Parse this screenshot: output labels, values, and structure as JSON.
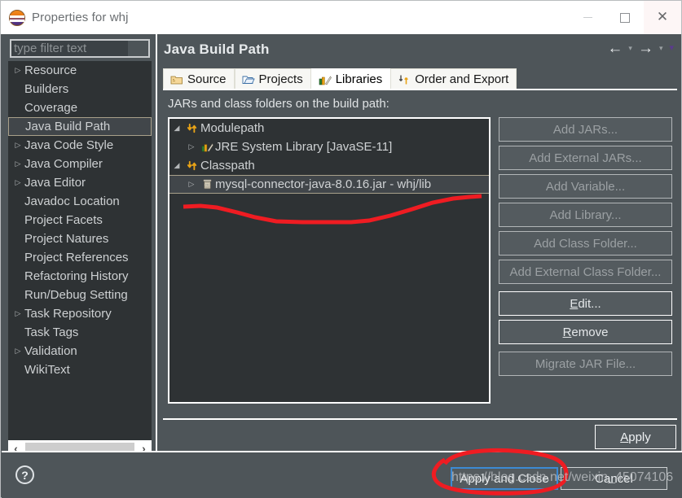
{
  "window": {
    "title": "Properties for whj",
    "icon": "eclipse-icon",
    "controls": {
      "minimize": "—",
      "maximize": "□",
      "close": "✕"
    }
  },
  "sidebar": {
    "filter": {
      "value": "",
      "placeholder": "type filter text"
    },
    "items": [
      {
        "label": "Resource",
        "expandable": true,
        "selected": false
      },
      {
        "label": "Builders",
        "expandable": false,
        "selected": false
      },
      {
        "label": "Coverage",
        "expandable": false,
        "selected": false
      },
      {
        "label": "Java Build Path",
        "expandable": false,
        "selected": true
      },
      {
        "label": "Java Code Style",
        "expandable": true,
        "selected": false
      },
      {
        "label": "Java Compiler",
        "expandable": true,
        "selected": false
      },
      {
        "label": "Java Editor",
        "expandable": true,
        "selected": false
      },
      {
        "label": "Javadoc Location",
        "expandable": false,
        "selected": false
      },
      {
        "label": "Project Facets",
        "expandable": false,
        "selected": false
      },
      {
        "label": "Project Natures",
        "expandable": false,
        "selected": false
      },
      {
        "label": "Project References",
        "expandable": false,
        "selected": false
      },
      {
        "label": "Refactoring History",
        "expandable": false,
        "selected": false
      },
      {
        "label": "Run/Debug Setting",
        "expandable": false,
        "selected": false
      },
      {
        "label": "Task Repository",
        "expandable": true,
        "selected": false
      },
      {
        "label": "Task Tags",
        "expandable": false,
        "selected": false
      },
      {
        "label": "Validation",
        "expandable": true,
        "selected": false
      },
      {
        "label": "WikiText",
        "expandable": false,
        "selected": false
      }
    ],
    "scroll": {
      "left_arrow": "‹",
      "right_arrow": "›"
    }
  },
  "main": {
    "page_title": "Java Build Path",
    "nav": {
      "back": "←",
      "back_caret": "▾",
      "forward": "→",
      "forward_caret": "▾",
      "menu_caret": "▾"
    },
    "tabs": [
      {
        "label": "Source",
        "icon": "source-folder-icon",
        "active": false
      },
      {
        "label": "Projects",
        "icon": "open-folder-icon",
        "active": false
      },
      {
        "label": "Libraries",
        "icon": "books-icon",
        "active": true
      },
      {
        "label": "Order and Export",
        "icon": "order-export-icon",
        "active": false
      }
    ],
    "list_label": "JARs and class folders on the build path:",
    "tree": [
      {
        "label": "Modulepath",
        "icon": "path-arrows-icon",
        "depth": 0,
        "twisty": "◢",
        "selected": false
      },
      {
        "label": "JRE System Library [JavaSE-11]",
        "icon": "books-icon",
        "depth": 1,
        "twisty": "▷",
        "selected": false
      },
      {
        "label": "Classpath",
        "icon": "path-arrows-icon",
        "depth": 0,
        "twisty": "◢",
        "selected": false
      },
      {
        "label": "mysql-connector-java-8.0.16.jar - whj/lib",
        "icon": "jar-icon",
        "depth": 1,
        "twisty": "▷",
        "selected": true
      }
    ],
    "buttons": [
      {
        "label": "Add JARs...",
        "disabled": true,
        "gap": false
      },
      {
        "label": "Add External JARs...",
        "disabled": true,
        "gap": false
      },
      {
        "label": "Add Variable...",
        "disabled": true,
        "gap": false
      },
      {
        "label": "Add Library...",
        "disabled": true,
        "gap": false
      },
      {
        "label": "Add Class Folder...",
        "disabled": true,
        "gap": false
      },
      {
        "label": "Add External Class Folder...",
        "disabled": true,
        "gap": false
      },
      {
        "label": "Edit...",
        "disabled": false,
        "gap": true
      },
      {
        "label": "Remove",
        "disabled": false,
        "gap": false
      },
      {
        "label": "Migrate JAR File...",
        "disabled": true,
        "gap": true
      }
    ],
    "apply_label": "Apply"
  },
  "footer": {
    "help_icon": "?",
    "apply_and_close": "Apply and Close",
    "cancel": "Cancel"
  },
  "annotations": {
    "watermark": "https://blog.csdn.net/weixin_45074106",
    "ink_color": "#ef1c22"
  },
  "colors": {
    "window_bg": "#4e5559",
    "tree_bg": "#2e3234",
    "selection_border": "#a8a08a",
    "focus_blue": "#3c8ad4",
    "titlebar_bg": "#ffffff"
  }
}
